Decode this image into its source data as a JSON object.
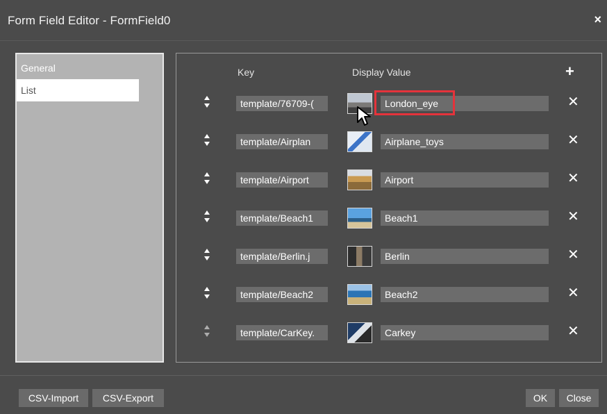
{
  "window": {
    "title": "Form Field Editor - FormField0",
    "close_symbol": "×"
  },
  "nav": {
    "items": [
      {
        "label": "General"
      },
      {
        "label": "List"
      }
    ],
    "active": "List"
  },
  "list": {
    "header_key": "Key",
    "header_display": "Display Value",
    "add_symbol": "+",
    "delete_symbol": "✕",
    "rows": [
      {
        "key": "template/76709-(",
        "display": "London_eye",
        "thumb": "london-eye-thumbnail"
      },
      {
        "key": "template/Airplan",
        "display": "Airplane_toys",
        "thumb": "airplane-thumbnail"
      },
      {
        "key": "template/Airport",
        "display": "Airport",
        "thumb": "airport-thumbnail"
      },
      {
        "key": "template/Beach1",
        "display": "Beach1",
        "thumb": "beach1-thumbnail"
      },
      {
        "key": "template/Berlin.j",
        "display": "Berlin",
        "thumb": "berlin-thumbnail"
      },
      {
        "key": "template/Beach2",
        "display": "Beach2",
        "thumb": "beach2-thumbnail"
      },
      {
        "key": "template/CarKey.",
        "display": "Carkey",
        "thumb": "carkey-thumbnail"
      }
    ]
  },
  "footer": {
    "csv_import": "CSV-Import",
    "csv_export": "CSV-Export",
    "ok": "OK",
    "close": "Close"
  },
  "colors": {
    "background": "#4b4b4b",
    "field": "#6c6c6c",
    "nav_panel": "#b3b3b3",
    "highlight": "#e5333b"
  }
}
